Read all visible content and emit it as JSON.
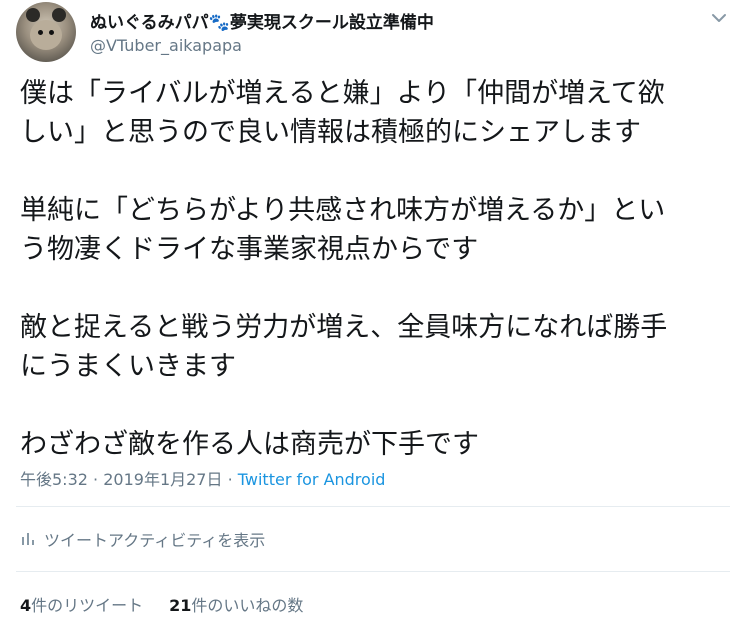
{
  "author": {
    "display_name": "ぬいぐるみパパ🐾夢実現スクール設立準備中",
    "handle": "@VTuber_aikapapa"
  },
  "tweet": {
    "paragraphs": [
      [
        "僕は「ライバルが増えると嫌」より「仲間が増えて欲",
        "しい」と思うので良い情報は積極的にシェアします"
      ],
      [
        "単純に「どちらがより共感され味方が増えるか」とい",
        "う物凄くドライな事業家視点からです"
      ],
      [
        "敵と捉えると戦う労力が増え、全員味方になれば勝手",
        "にうまくいきます"
      ],
      [
        "わざわざ敵を作る人は商売が下手です"
      ]
    ]
  },
  "meta": {
    "time": "午後5:32",
    "separator": "·",
    "date": "2019年1月27日",
    "source": "Twitter for Android"
  },
  "activity": {
    "label": "ツイートアクティビティを表示",
    "icon": "activity-icon"
  },
  "stats": {
    "retweet_count": "4",
    "retweet_label": "件のリツイート",
    "like_count": "21",
    "like_label": "件のいいねの数"
  },
  "icons": {
    "caret": "chevron-down-icon",
    "avatar": "avatar"
  }
}
